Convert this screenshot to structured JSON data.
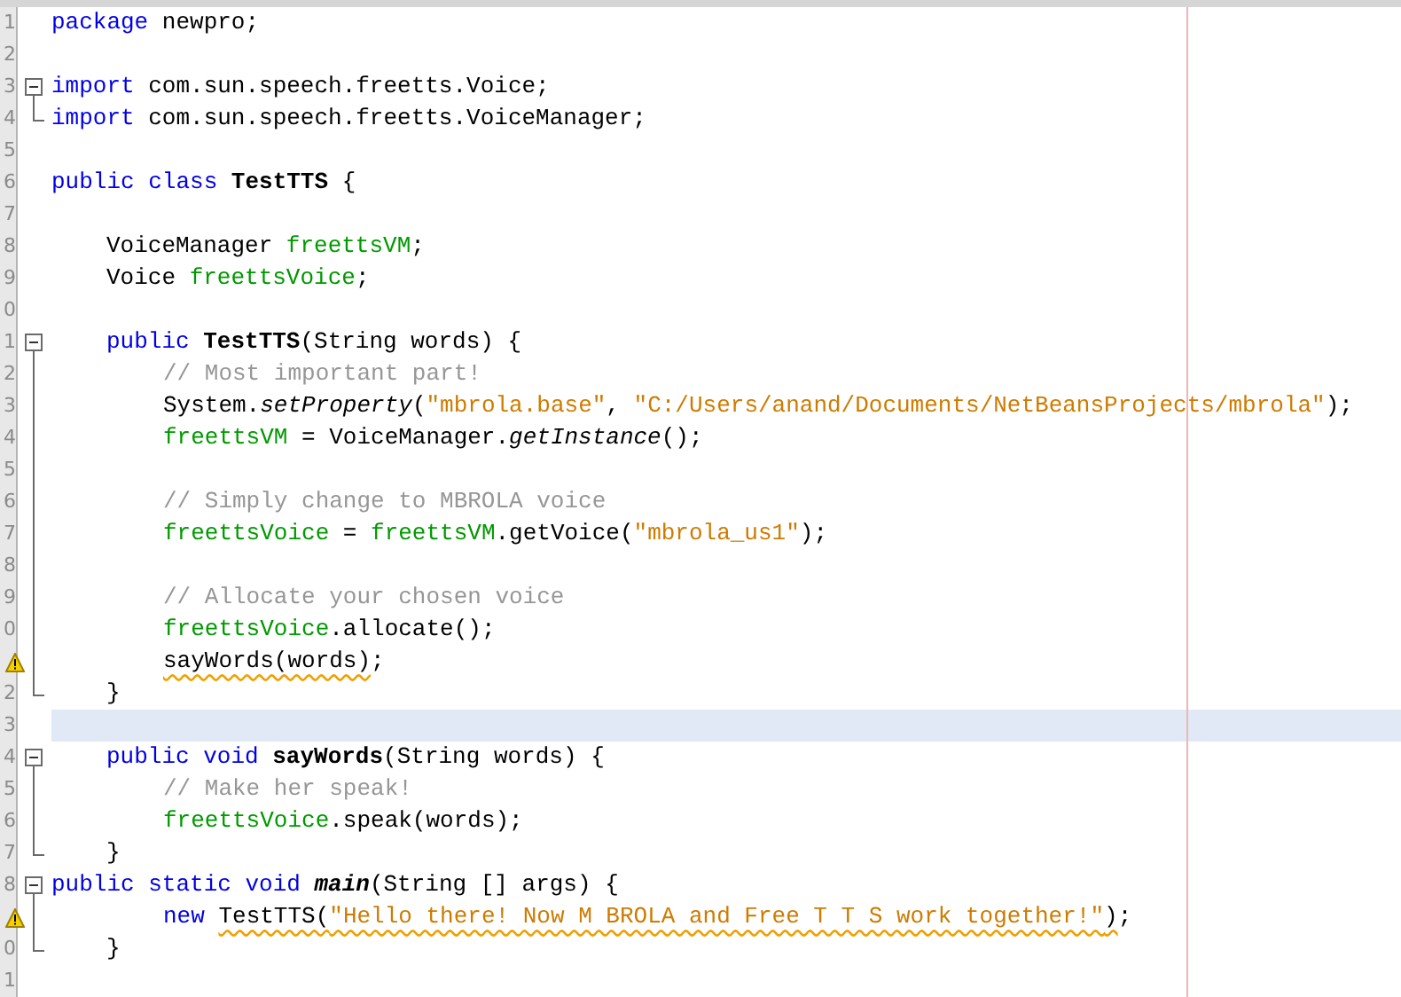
{
  "editor": {
    "lines": [
      {
        "gutter": {
          "kind": "number",
          "text": "1"
        },
        "current": false,
        "indent": {
          "kind": "none"
        },
        "tokens": [
          {
            "kind": "keyword",
            "text": "package "
          },
          {
            "kind": "plain",
            "text": "newpro;"
          }
        ]
      },
      {
        "gutter": {
          "kind": "number",
          "text": "2"
        },
        "current": false
      },
      {
        "gutter": {
          "kind": "number",
          "text": "3"
        },
        "current": false,
        "fold": {
          "kind": "open"
        },
        "indent": {
          "kind": "none"
        },
        "tokens": [
          {
            "kind": "keyword",
            "text": "import "
          },
          {
            "kind": "plain",
            "text": "com.sun.speech.freetts.Voice;"
          }
        ]
      },
      {
        "gutter": {
          "kind": "number",
          "text": "4"
        },
        "current": false,
        "fold": {
          "kind": "end"
        },
        "indent": {
          "kind": "none"
        },
        "tokens": [
          {
            "kind": "keyword",
            "text": "import "
          },
          {
            "kind": "plain",
            "text": "com.sun.speech.freetts.VoiceManager;"
          }
        ]
      },
      {
        "gutter": {
          "kind": "number",
          "text": "5"
        },
        "current": false
      },
      {
        "gutter": {
          "kind": "number",
          "text": "6"
        },
        "current": false,
        "indent": {
          "kind": "none"
        },
        "tokens": [
          {
            "kind": "keyword",
            "text": "public class "
          },
          {
            "kind": "bold",
            "text": "TestTTS"
          },
          {
            "kind": "plain",
            "text": " {"
          }
        ]
      },
      {
        "gutter": {
          "kind": "number",
          "text": "7"
        },
        "current": false
      },
      {
        "gutter": {
          "kind": "number",
          "text": "8"
        },
        "current": false,
        "indent": {
          "kind": "member"
        },
        "tokens": [
          {
            "kind": "plain",
            "text": "VoiceManager "
          },
          {
            "kind": "field",
            "text": "freettsVM"
          },
          {
            "kind": "plain",
            "text": ";"
          }
        ]
      },
      {
        "gutter": {
          "kind": "number",
          "text": "9"
        },
        "current": false,
        "indent": {
          "kind": "member"
        },
        "tokens": [
          {
            "kind": "plain",
            "text": "Voice "
          },
          {
            "kind": "field",
            "text": "freettsVoice"
          },
          {
            "kind": "plain",
            "text": ";"
          }
        ]
      },
      {
        "gutter": {
          "kind": "number",
          "text": "0"
        },
        "current": false
      },
      {
        "gutter": {
          "kind": "number",
          "text": "1"
        },
        "current": false,
        "fold": {
          "kind": "open"
        },
        "indent": {
          "kind": "member"
        },
        "tokens": [
          {
            "kind": "keyword",
            "text": "public "
          },
          {
            "kind": "bold",
            "text": "TestTTS"
          },
          {
            "kind": "plain",
            "text": "(String words) {"
          }
        ]
      },
      {
        "gutter": {
          "kind": "number",
          "text": "2"
        },
        "current": false,
        "fold": {
          "kind": "line"
        },
        "indent": {
          "kind": "body"
        },
        "tokens": [
          {
            "kind": "comment",
            "text": "// Most important part!"
          }
        ]
      },
      {
        "gutter": {
          "kind": "number",
          "text": "3"
        },
        "current": false,
        "fold": {
          "kind": "line"
        },
        "indent": {
          "kind": "body"
        },
        "tokens": [
          {
            "kind": "plain",
            "text": "System."
          },
          {
            "kind": "italic",
            "text": "setProperty"
          },
          {
            "kind": "plain",
            "text": "("
          },
          {
            "kind": "string",
            "text": "\"mbrola.base\""
          },
          {
            "kind": "plain",
            "text": ", "
          },
          {
            "kind": "string",
            "text": "\"C:/Users/anand/Documents/NetBeansProjects/mbrola\""
          },
          {
            "kind": "plain",
            "text": ");"
          }
        ]
      },
      {
        "gutter": {
          "kind": "number",
          "text": "4"
        },
        "current": false,
        "fold": {
          "kind": "line"
        },
        "indent": {
          "kind": "body"
        },
        "tokens": [
          {
            "kind": "field",
            "text": "freettsVM"
          },
          {
            "kind": "plain",
            "text": " = VoiceManager."
          },
          {
            "kind": "italic",
            "text": "getInstance"
          },
          {
            "kind": "plain",
            "text": "();"
          }
        ]
      },
      {
        "gutter": {
          "kind": "number",
          "text": "5"
        },
        "current": false,
        "fold": {
          "kind": "line"
        }
      },
      {
        "gutter": {
          "kind": "number",
          "text": "6"
        },
        "current": false,
        "fold": {
          "kind": "line"
        },
        "indent": {
          "kind": "body"
        },
        "tokens": [
          {
            "kind": "comment",
            "text": "// Simply change to MBROLA voice"
          }
        ]
      },
      {
        "gutter": {
          "kind": "number",
          "text": "7"
        },
        "current": false,
        "fold": {
          "kind": "line"
        },
        "indent": {
          "kind": "body"
        },
        "tokens": [
          {
            "kind": "field",
            "text": "freettsVoice"
          },
          {
            "kind": "plain",
            "text": " = "
          },
          {
            "kind": "field",
            "text": "freettsVM"
          },
          {
            "kind": "plain",
            "text": ".getVoice("
          },
          {
            "kind": "string",
            "text": "\"mbrola_us1\""
          },
          {
            "kind": "plain",
            "text": ");"
          }
        ]
      },
      {
        "gutter": {
          "kind": "number",
          "text": "8"
        },
        "current": false,
        "fold": {
          "kind": "line"
        }
      },
      {
        "gutter": {
          "kind": "number",
          "text": "9"
        },
        "current": false,
        "fold": {
          "kind": "line"
        },
        "indent": {
          "kind": "body"
        },
        "tokens": [
          {
            "kind": "comment",
            "text": "// Allocate your chosen voice"
          }
        ]
      },
      {
        "gutter": {
          "kind": "number",
          "text": "0"
        },
        "current": false,
        "fold": {
          "kind": "line"
        },
        "indent": {
          "kind": "body"
        },
        "tokens": [
          {
            "kind": "field",
            "text": "freettsVoice"
          },
          {
            "kind": "plain",
            "text": ".allocate();"
          }
        ]
      },
      {
        "gutter": {
          "kind": "warning"
        },
        "current": false,
        "fold": {
          "kind": "line"
        },
        "indent": {
          "kind": "body"
        },
        "tokens": [
          {
            "kind": "warn",
            "text": "sayWords(words)"
          },
          {
            "kind": "plain",
            "text": ";"
          }
        ]
      },
      {
        "gutter": {
          "kind": "number",
          "text": "2"
        },
        "current": false,
        "fold": {
          "kind": "end"
        },
        "indent": {
          "kind": "member"
        },
        "tokens": [
          {
            "kind": "plain",
            "text": "}"
          }
        ]
      },
      {
        "gutter": {
          "kind": "number",
          "text": "3"
        },
        "current": true
      },
      {
        "gutter": {
          "kind": "number",
          "text": "4"
        },
        "current": false,
        "fold": {
          "kind": "open"
        },
        "indent": {
          "kind": "member"
        },
        "tokens": [
          {
            "kind": "keyword",
            "text": "public void "
          },
          {
            "kind": "bold",
            "text": "sayWords"
          },
          {
            "kind": "plain",
            "text": "(String words) {"
          }
        ]
      },
      {
        "gutter": {
          "kind": "number",
          "text": "5"
        },
        "current": false,
        "fold": {
          "kind": "line"
        },
        "indent": {
          "kind": "body"
        },
        "tokens": [
          {
            "kind": "comment",
            "text": "// Make her speak!"
          }
        ]
      },
      {
        "gutter": {
          "kind": "number",
          "text": "6"
        },
        "current": false,
        "fold": {
          "kind": "line"
        },
        "indent": {
          "kind": "body"
        },
        "tokens": [
          {
            "kind": "field",
            "text": "freettsVoice"
          },
          {
            "kind": "plain",
            "text": ".speak(words);"
          }
        ]
      },
      {
        "gutter": {
          "kind": "number",
          "text": "7"
        },
        "current": false,
        "fold": {
          "kind": "end"
        },
        "indent": {
          "kind": "member"
        },
        "tokens": [
          {
            "kind": "plain",
            "text": "}"
          }
        ]
      },
      {
        "gutter": {
          "kind": "number",
          "text": "8"
        },
        "current": false,
        "fold": {
          "kind": "open"
        },
        "indent": {
          "kind": "none"
        },
        "tokens": [
          {
            "kind": "keyword",
            "text": "public static void "
          },
          {
            "kind": "bold-italic",
            "text": "main"
          },
          {
            "kind": "plain",
            "text": "(String [] args) {"
          }
        ]
      },
      {
        "gutter": {
          "kind": "warning"
        },
        "current": false,
        "fold": {
          "kind": "line"
        },
        "indent": {
          "kind": "body"
        },
        "tokens": [
          {
            "kind": "keyword",
            "text": "new "
          },
          {
            "kind": "warn",
            "text": "TestTTS("
          },
          {
            "kind": "warn-string",
            "text": "\"Hello there! Now M BROLA and Free T T S work together!\""
          },
          {
            "kind": "warn",
            "text": ")"
          },
          {
            "kind": "plain",
            "text": ";"
          }
        ]
      },
      {
        "gutter": {
          "kind": "number",
          "text": "0"
        },
        "current": false,
        "fold": {
          "kind": "end"
        },
        "indent": {
          "kind": "member"
        },
        "tokens": [
          {
            "kind": "plain",
            "text": "}"
          }
        ]
      },
      {
        "gutter": {
          "kind": "number",
          "text": "1"
        },
        "current": false
      }
    ]
  }
}
